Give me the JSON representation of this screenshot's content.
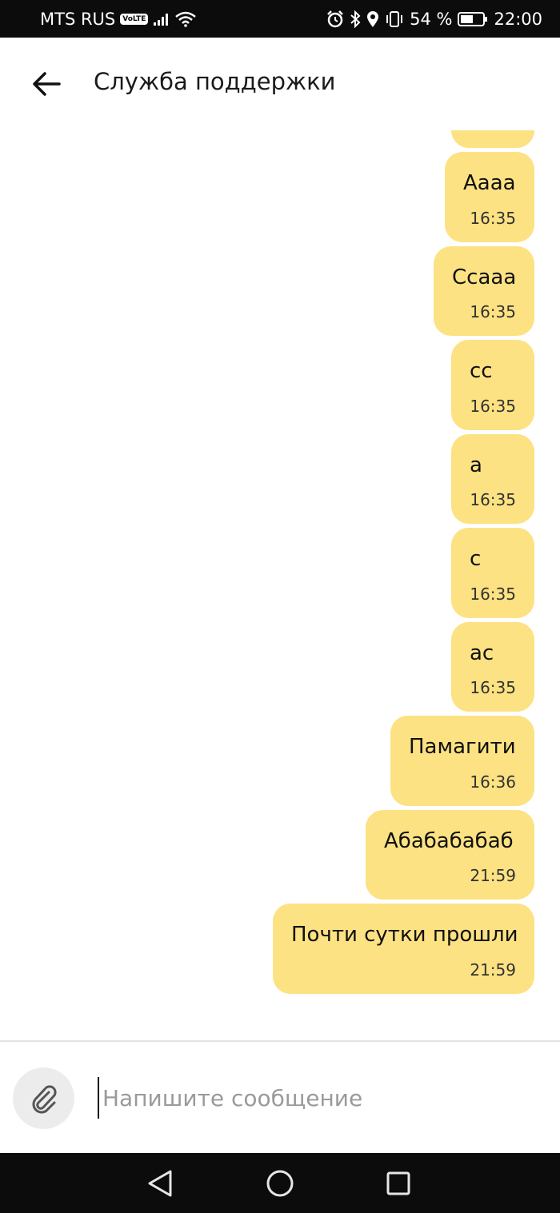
{
  "status_bar": {
    "carrier": "MTS RUS",
    "volte": "VoLTE",
    "battery_percent": "54 %",
    "time": "22:00",
    "icons": [
      "signal-icon",
      "wifi-icon",
      "alarm-icon",
      "bluetooth-icon",
      "location-icon",
      "vibrate-icon",
      "battery-icon"
    ]
  },
  "header": {
    "title": "Служба поддержки",
    "back_icon": "arrow-left-icon"
  },
  "messages": [
    {
      "text": "",
      "time": ""
    },
    {
      "text": "Аааа",
      "time": "16:35"
    },
    {
      "text": "Ccaaa",
      "time": "16:35"
    },
    {
      "text": "cc",
      "time": "16:35"
    },
    {
      "text": "а",
      "time": "16:35"
    },
    {
      "text": "с",
      "time": "16:35"
    },
    {
      "text": "ас",
      "time": "16:35"
    },
    {
      "text": "Памагити",
      "time": "16:36"
    },
    {
      "text": "Абабабабаб",
      "time": "21:59"
    },
    {
      "text": "Почти сутки прошли",
      "time": "21:59"
    }
  ],
  "composer": {
    "attach_icon": "paperclip-icon",
    "placeholder": "Напишите сообщение",
    "value": ""
  },
  "nav_bar": {
    "icons": [
      "back-triangle-icon",
      "home-circle-icon",
      "recents-square-icon"
    ]
  },
  "colors": {
    "bubble": "#fce282",
    "status_bar": "#0c0c0c",
    "attach_bg": "#ececec"
  }
}
